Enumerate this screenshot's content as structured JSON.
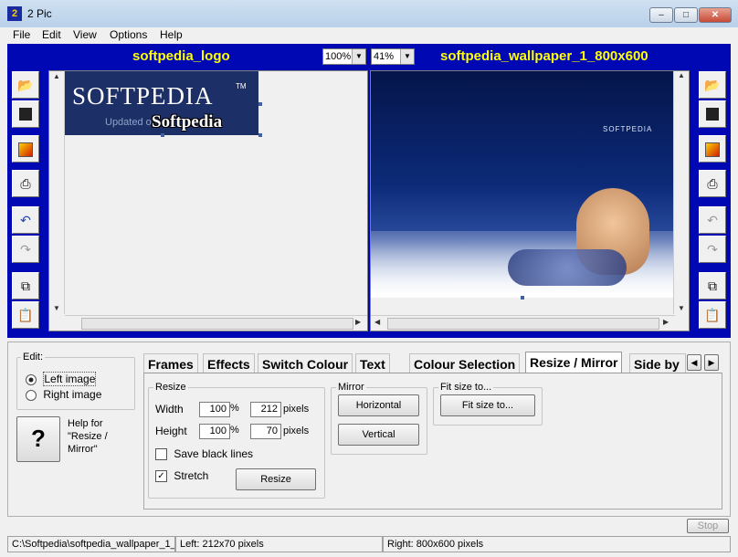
{
  "window": {
    "title": "2 Pic",
    "icon": "2"
  },
  "menu": [
    "File",
    "Edit",
    "View",
    "Options",
    "Help"
  ],
  "left_panel": {
    "name": "softpedia_logo",
    "zoom": "100%",
    "logo_text": "SOFTPEDIA",
    "logo_tm": "TM",
    "logo_sub": "Updated o",
    "logo_overlay": "Softpedia"
  },
  "right_panel": {
    "name": "softpedia_wallpaper_1_800x600",
    "zoom": "41%",
    "wall_logo": "SOFTPEDIA"
  },
  "edit": {
    "label": "Edit:",
    "options": [
      "Left image",
      "Right image"
    ],
    "selected": "Left image"
  },
  "help": {
    "icon": "?",
    "text": "Help for \"Resize / Mirror\""
  },
  "tabs": [
    "Frames",
    "Effects",
    "Switch Colour",
    "Text",
    "Colour Selection",
    "Resize / Mirror",
    "Side by"
  ],
  "active_tab": "Resize / Mirror",
  "resize": {
    "group_label": "Resize",
    "width_label": "Width",
    "width_pct": "100",
    "width_px": "212",
    "height_label": "Height",
    "height_pct": "100",
    "height_px": "70",
    "pct_unit": "%",
    "px_unit": "pixels",
    "save_black_lines": "Save black lines",
    "save_black_lines_checked": false,
    "stretch": "Stretch",
    "stretch_checked": true,
    "button": "Resize"
  },
  "mirror": {
    "group_label": "Mirror",
    "horizontal": "Horizontal",
    "vertical": "Vertical"
  },
  "fit": {
    "group_label": "Fit size to...",
    "button": "Fit size to..."
  },
  "stop_button": "Stop",
  "status": {
    "path": "C:\\Softpedia\\softpedia_wallpaper_1_",
    "left": "Left: 212x70 pixels",
    "right": "Right: 800x600 pixels"
  },
  "colors": {
    "panel_blue": "#0008b4",
    "title_yellow": "#ffff00"
  }
}
